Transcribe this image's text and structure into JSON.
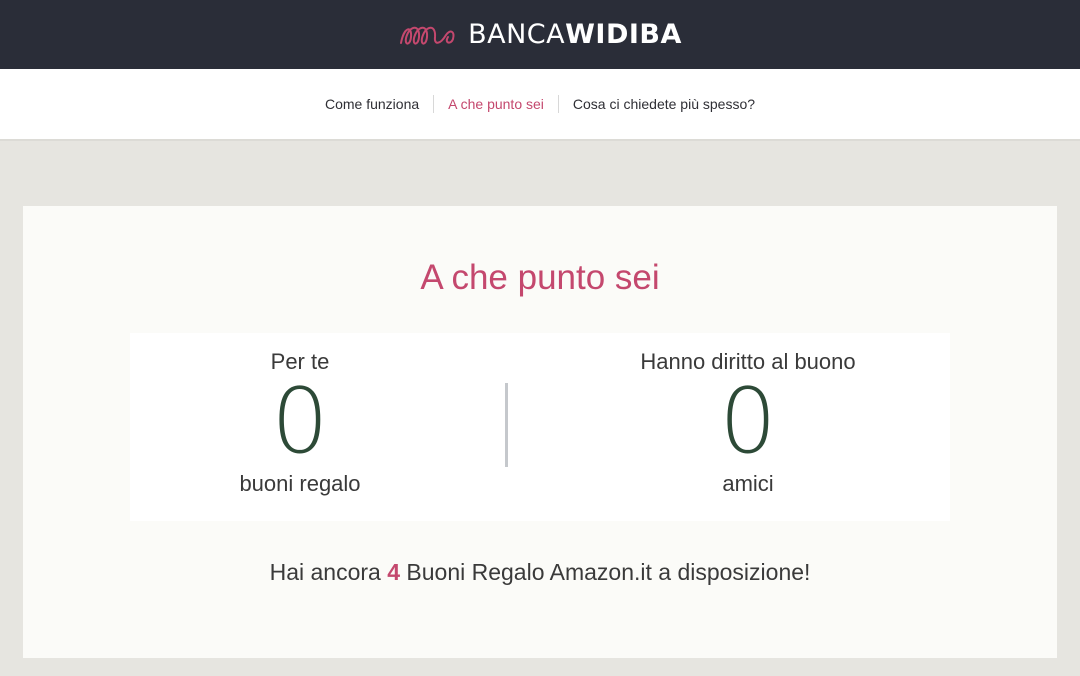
{
  "header": {
    "brand_light": "BANCA",
    "brand_bold": "WIDIBA",
    "brand_color": "#c4486e",
    "bar_color": "#2a2d38"
  },
  "nav": {
    "items": [
      {
        "label": "Come funziona",
        "active": false
      },
      {
        "label": "A che punto sei",
        "active": true
      },
      {
        "label": "Cosa ci chiedete più spesso?",
        "active": false
      }
    ]
  },
  "card": {
    "title": "A che punto sei",
    "left": {
      "label": "Per te",
      "value": "0",
      "unit": "buoni regalo"
    },
    "right": {
      "label": "Hanno diritto al buono",
      "value": "0",
      "unit": "amici"
    },
    "summary_before": "Hai ancora ",
    "summary_count": "4",
    "summary_after": " Buoni Regalo Amazon.it a disposizione!"
  },
  "colors": {
    "accent": "#c4486e",
    "counter": "#2d4a37",
    "background": "#e6e5e0"
  }
}
